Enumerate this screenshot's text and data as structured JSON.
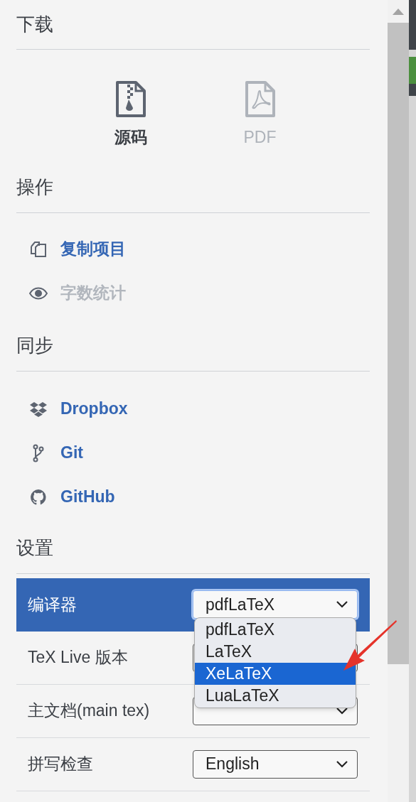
{
  "download": {
    "title": "下载",
    "items": [
      {
        "label": "源码",
        "disabled": false
      },
      {
        "label": "PDF",
        "disabled": true
      }
    ]
  },
  "actions": {
    "title": "操作",
    "items": [
      {
        "label": "复制项目",
        "disabled": false
      },
      {
        "label": "字数统计",
        "disabled": true
      }
    ]
  },
  "sync": {
    "title": "同步",
    "items": [
      {
        "label": "Dropbox"
      },
      {
        "label": "Git"
      },
      {
        "label": "GitHub"
      }
    ]
  },
  "settings": {
    "title": "设置",
    "rows": [
      {
        "label": "编译器",
        "value": "pdfLaTeX",
        "selected": true
      },
      {
        "label": "TeX Live 版本",
        "selected": false
      },
      {
        "label": "主文档(main tex)",
        "selected": false
      },
      {
        "label": "拼写检查",
        "value": "English",
        "selected": false
      }
    ]
  },
  "compiler_menu": {
    "options": [
      {
        "label": "pdfLaTeX",
        "selected": false
      },
      {
        "label": "LaTeX",
        "selected": false
      },
      {
        "label": "XeLaTeX",
        "selected": true
      },
      {
        "label": "LuaLaTeX",
        "selected": false
      }
    ]
  }
}
